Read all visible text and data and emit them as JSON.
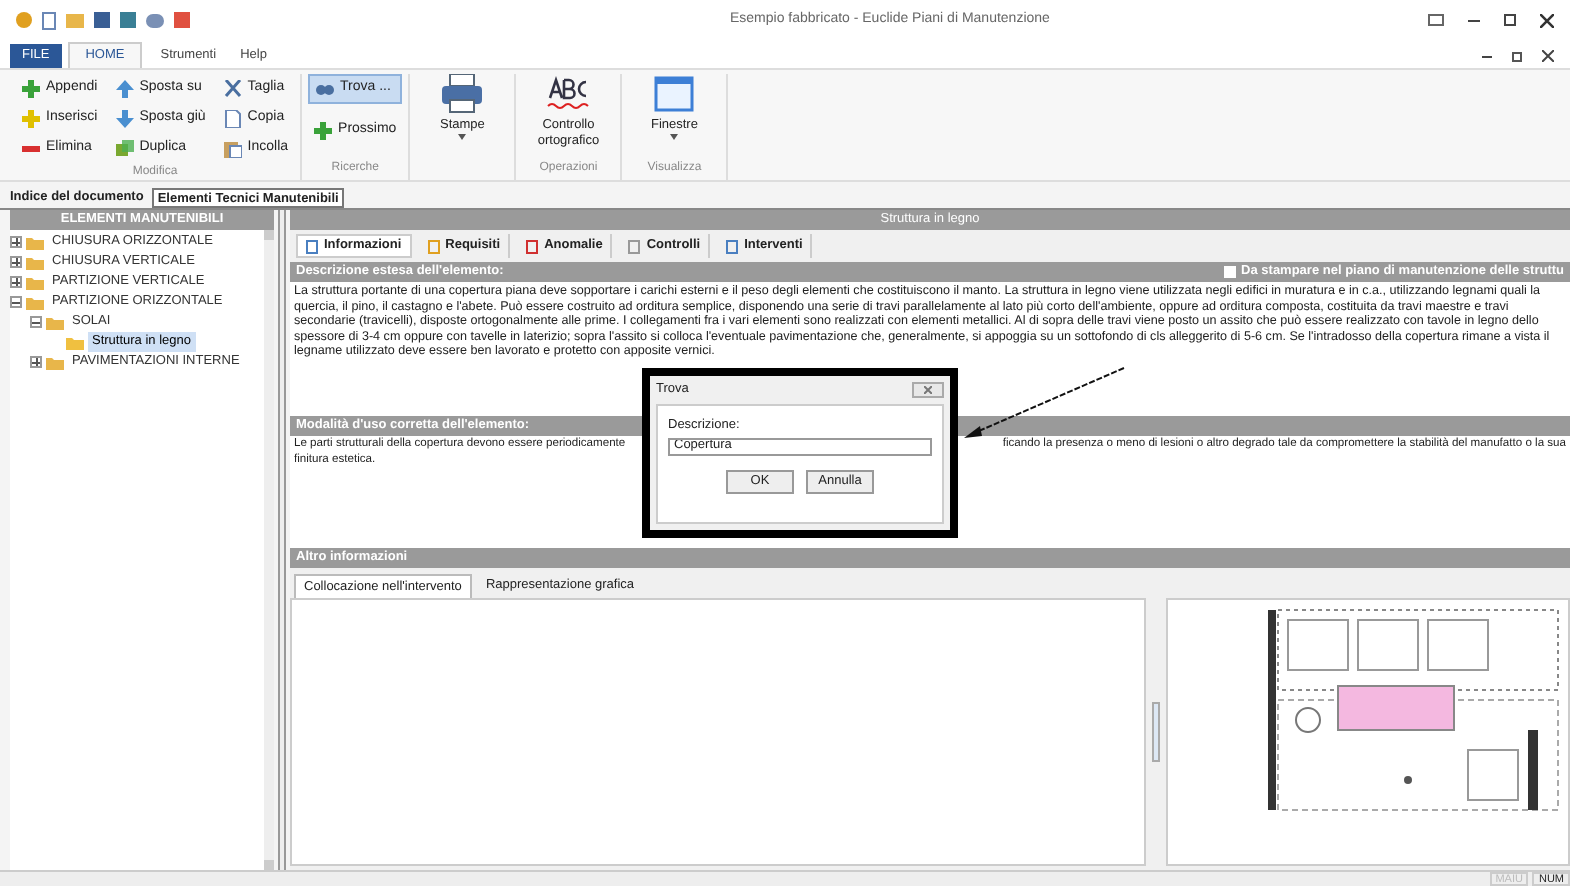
{
  "window": {
    "title": "Esempio fabbricato - Euclide Piani di Manutenzione"
  },
  "ribbon_tabs": [
    {
      "label": "FILE",
      "kind": "file",
      "selected": false
    },
    {
      "label": "HOME",
      "kind": "tab",
      "selected": true
    },
    {
      "label": "Strumenti",
      "kind": "tab",
      "selected": false
    },
    {
      "label": "Help",
      "kind": "tab",
      "selected": false
    }
  ],
  "ribbon_groups": [
    {
      "title": "Modifica",
      "columns": [
        [
          "Appendi",
          "Inserisci",
          "Elimina"
        ],
        [
          "Sposta su",
          "Sposta giù",
          "Duplica"
        ],
        [
          "Taglia",
          "Copia",
          "Incolla"
        ]
      ]
    },
    {
      "title": "Ricerche",
      "buttons": [
        {
          "label": "Trova ...",
          "highlighted": true
        },
        {
          "label": "Prossimo",
          "highlighted": false
        }
      ]
    },
    {
      "big": [
        {
          "label": "Stampe",
          "dropdown": true
        }
      ]
    },
    {
      "title": "Operazioni",
      "big": [
        {
          "label": "Controllo ortografico",
          "dropdown": false
        }
      ]
    },
    {
      "title": "Visualizza",
      "big": [
        {
          "label": "Finestre",
          "dropdown": true
        }
      ]
    }
  ],
  "document_tabs": [
    {
      "label": "Indice del documento",
      "selected": false
    },
    {
      "label": "Elementi Tecnici Manutenibili",
      "selected": true
    }
  ],
  "tree": {
    "title": "ELEMENTI MANUTENIBILI",
    "items": [
      {
        "label": "CHIUSURA ORIZZONTALE",
        "expanded": false,
        "selected": false
      },
      {
        "label": "CHIUSURA VERTICALE",
        "expanded": false,
        "selected": false
      },
      {
        "label": "PARTIZIONE VERTICALE",
        "expanded": false,
        "selected": false
      },
      {
        "label": "PARTIZIONE ORIZZONTALE",
        "expanded": true,
        "selected": false,
        "children": [
          {
            "label": "SOLAI",
            "expanded": true,
            "selected": false,
            "children": [
              {
                "label": "Struttura in legno",
                "selected": true
              }
            ]
          },
          {
            "label": "PAVIMENTAZIONI INTERNE",
            "expanded": false,
            "selected": false
          }
        ]
      }
    ]
  },
  "element": {
    "title": "Struttura in legno",
    "tabs": [
      {
        "label": "Informazioni",
        "selected": true
      },
      {
        "label": "Requisiti",
        "selected": false
      },
      {
        "label": "Anomalie",
        "selected": false
      },
      {
        "label": "Controlli",
        "selected": false
      },
      {
        "label": "Interventi",
        "selected": false
      }
    ],
    "description": {
      "title": "Descrizione estesa dell'elemento:",
      "print_option": {
        "label": "Da stampare nel piano di manutenzione delle struttu",
        "checked": false
      },
      "text": "La struttura portante di una copertura piana deve sopportare i carichi esterni e il peso degli elementi che costituiscono il manto. La struttura in legno  viene utilizzata negli edifici in muratura e in c.a., utilizzando legnami quali la quercia, il pino, il castagno e l'abete. Può essere costruito ad orditura semplice, disponendo una serie di travi parallelamente al lato più corto dell'ambiente, oppure ad orditura composta, costituita da travi maestre e travi secondarie (travicelli), disposte ortogonalmente alle prime. I collegamenti fra i vari elementi sono realizzati con elementi metallici.  Al di sopra delle travi viene posto un assito che può essere realizzato con tavole in legno dello spessore di 3-4 cm oppure con tavelle in laterizio; sopra l'assito si colloca l'eventuale pavimentazione che, generalmente, si appoggia su un sottofondo di cls alleggerito di 5-6 cm. Se l'intradosso della copertura rimane a vista il legname utilizzato deve essere ben lavorato e protetto con apposite vernici."
    },
    "usage": {
      "title": "Modalità d'uso corretta dell'elemento:",
      "line_1_start": "Le parti strutturali della copertura devono essere periodicamente",
      "line_1_end": "ficando la presenza o meno di lesioni o altro degrado tale da compromettere la stabilità del manufatto o la sua",
      "line_2": "finitura estetica."
    },
    "other": {
      "title": "Altro informazioni",
      "tabs": [
        {
          "label": "Collocazione nell'intervento",
          "selected": true
        },
        {
          "label": "Rappresentazione grafica",
          "selected": false
        }
      ]
    }
  },
  "dialog": {
    "title": "Trova",
    "field_label": "Descrizione:",
    "value": "Copertura",
    "buttons": [
      "OK",
      "Annulla"
    ]
  },
  "status_bar": {
    "indicators": [
      {
        "label": "MAIU",
        "on": false
      },
      {
        "label": "NUM",
        "on": true
      }
    ]
  }
}
